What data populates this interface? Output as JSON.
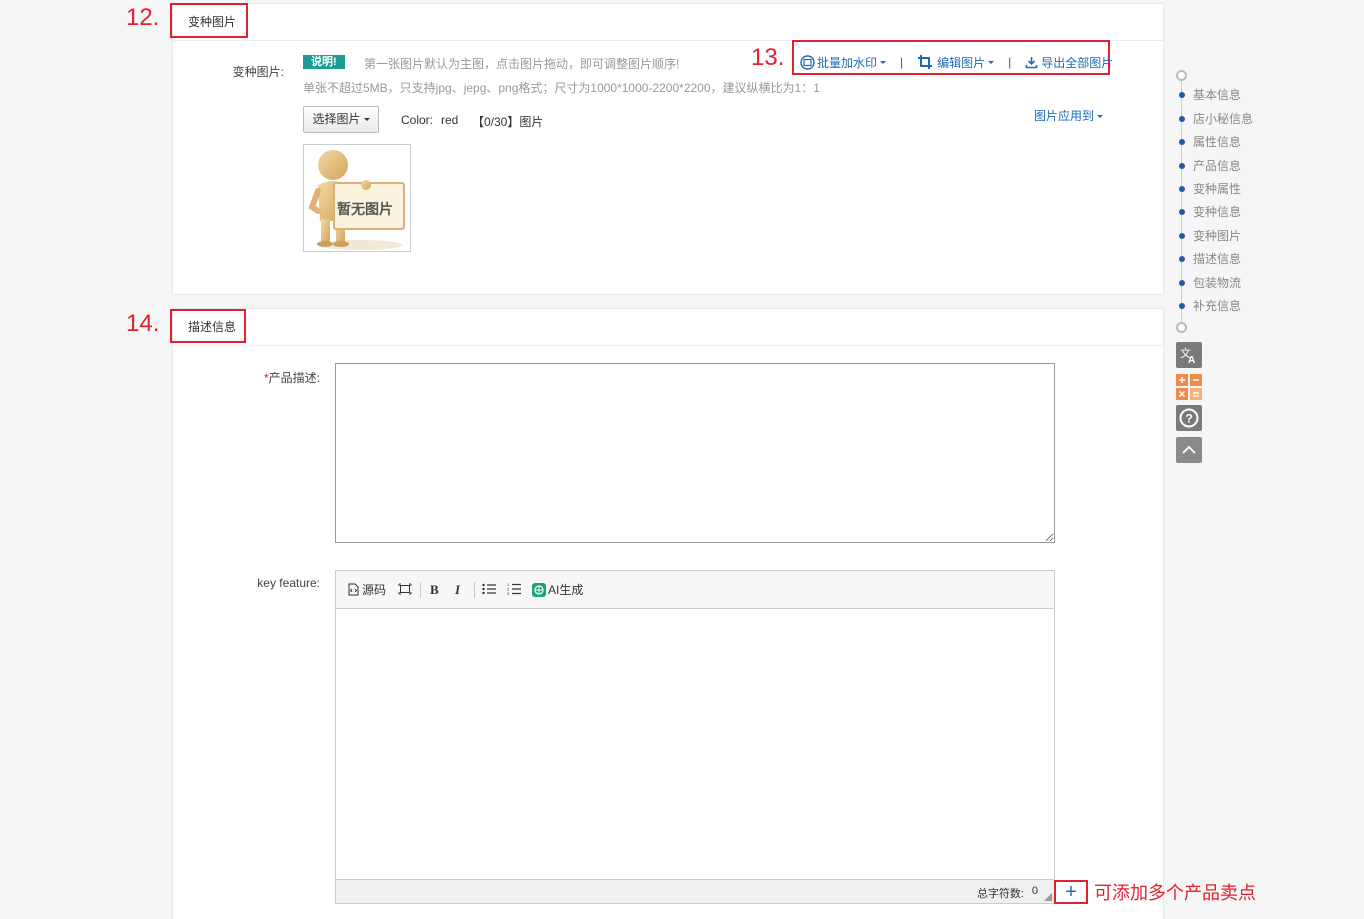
{
  "variant_section": {
    "number": "12.",
    "title": "变种图片",
    "field_label": "变种图片:",
    "badge": "说明!",
    "hint_line1": "第一张图片默认为主图，点击图片拖动，即可调整图片顺序!",
    "hint_line2": "单张不超过5MB，只支持jpg、jepg、png格式；尺寸为1000*1000-2200*2200，建议纵横比为1：1",
    "select_button": "选择图片",
    "color_label": "Color:",
    "color_value": "red",
    "count": "【0/30】图片",
    "apply_link": "图片应用到",
    "placeholder_text": "暂无图片",
    "toolbar_number": "13.",
    "toolbar": {
      "watermark": "批量加水印",
      "edit": "编辑图片",
      "export": "导出全部图片",
      "separator": "|"
    }
  },
  "desc_section": {
    "number": "14.",
    "title": "描述信息",
    "required_mark": "*",
    "product_desc_label": "产品描述:",
    "key_feature_label": "key feature:",
    "editor": {
      "source": "源码",
      "bold": "B",
      "italic": "I",
      "ai": "AI生成",
      "char_count_label": "总字符数:",
      "char_count": "0"
    },
    "add_button": "+",
    "add_annotation": "可添加多个产品卖点"
  },
  "sidebar": {
    "items": [
      "基本信息",
      "店小秘信息",
      "属性信息",
      "产品信息",
      "变种属性",
      "变种信息",
      "变种图片",
      "描述信息",
      "包装物流",
      "补充信息"
    ]
  },
  "colors": {
    "accent_red": "#e3212e",
    "link_blue": "#1e6bb8",
    "badge_teal": "#1a9e94",
    "nav_dot": "#1e5aa8"
  },
  "icons": [
    "picture-icon",
    "crop-icon",
    "download-icon",
    "translate-icon",
    "calculator-icon",
    "help-icon",
    "back-to-top-icon",
    "source-code-icon",
    "fullscreen-icon",
    "bullet-list-icon",
    "numbered-list-icon",
    "ai-icon"
  ]
}
